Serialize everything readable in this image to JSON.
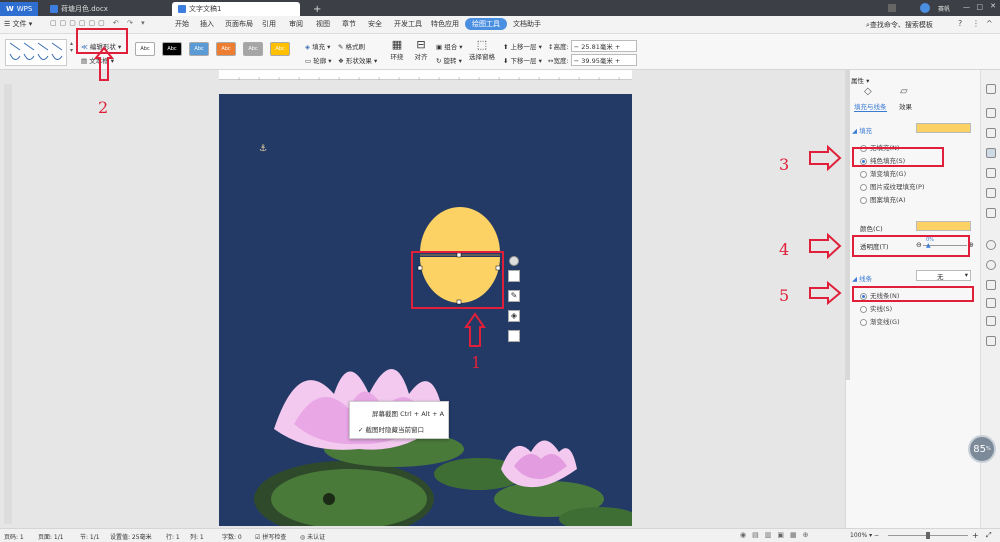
{
  "tabs": {
    "wps": "WPS",
    "doc1": "荷塘月色.docx",
    "doc2": "文字文稿1",
    "add": "+"
  },
  "titlebar": {
    "user": "赛帆"
  },
  "menubar": {
    "file": "文件",
    "items": [
      "开始",
      "插入",
      "页面布局",
      "引用",
      "审阅",
      "视图",
      "章节",
      "安全",
      "开发工具",
      "特色应用",
      "绘图工具",
      "文档助手"
    ],
    "search": "查找命令、搜索模板"
  },
  "ribbon": {
    "edit_shape": "编辑形状",
    "textbox": "文本框",
    "style_label": "Abc",
    "fill": "填充",
    "format_brush": "格式刷",
    "outline": "轮廓",
    "shape_effect": "形状效果",
    "wrap": "环绕",
    "align": "对齐",
    "group": "组合",
    "rotate": "旋转",
    "selection_pane": "选择窗格",
    "bring_forward": "上移一层",
    "send_backward": "下移一层",
    "height_label": "高度:",
    "height_value": "25.81毫米",
    "width_label": "宽度:",
    "width_value": "39.95毫米"
  },
  "context_menu": {
    "item1": "屏幕截图 Ctrl + Alt + A",
    "item2": "截图时隐藏当前窗口"
  },
  "panel": {
    "title": "属性",
    "tab_fill": "填充与线条",
    "tab_effect": "效果",
    "fill_section": "填充",
    "fill_none": "无填充(N)",
    "fill_solid": "纯色填充(S)",
    "fill_gradient": "渐变填充(G)",
    "fill_picture": "图片或纹理填充(P)",
    "fill_pattern": "图案填充(A)",
    "color_label": "颜色(C)",
    "transparency_label": "透明度(T)",
    "transparency_value": "0%",
    "line_section": "线条",
    "line_value": "无",
    "line_none": "无线条(N)",
    "line_solid": "实线(S)",
    "line_gradient": "渐变线(G)"
  },
  "annotations": [
    "1",
    "2",
    "3",
    "4",
    "5"
  ],
  "status": {
    "page": "页码: 1",
    "pages": "页面: 1/1",
    "section": "节: 1/1",
    "setting": "设置值: 25毫米",
    "row": "行: 1",
    "col": "列: 1",
    "words": "字数: 0",
    "spell": "拼写检查",
    "cert": "未认证",
    "zoom": "100%"
  },
  "zoom_badge": "85",
  "zoom_badge_unit": "%",
  "colors": {
    "accent": "#4a8fe0",
    "moon": "#fdd265",
    "page_bg": "#233a66",
    "annotation": "#e0203a"
  }
}
